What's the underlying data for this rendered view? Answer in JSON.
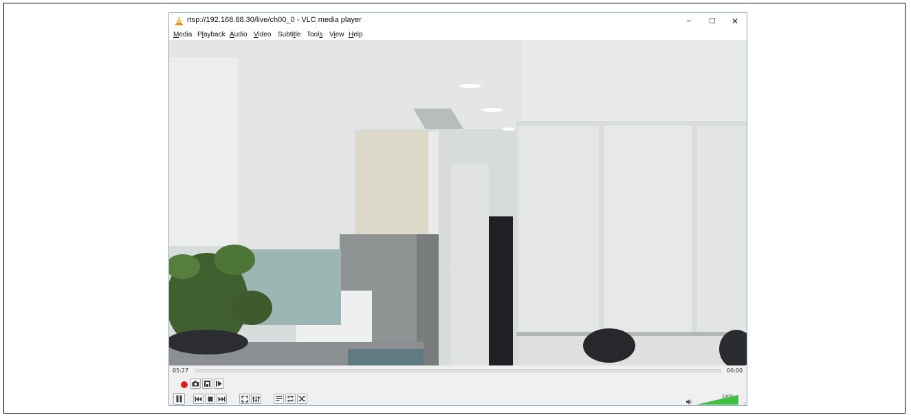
{
  "window": {
    "title": "rtsp://192.168.88.30/live/ch00_0 - VLC media player",
    "minimize_glyph": "−",
    "maximize_glyph": "☐",
    "close_glyph": "✕"
  },
  "menu": [
    {
      "pre": "",
      "u": "M",
      "post": "edia"
    },
    {
      "pre": "P",
      "u": "l",
      "post": "ayback"
    },
    {
      "pre": "",
      "u": "A",
      "post": "udio"
    },
    {
      "pre": "",
      "u": "V",
      "post": "ideo"
    },
    {
      "pre": "Subti",
      "u": "t",
      "post": "le"
    },
    {
      "pre": "Tool",
      "u": "s",
      "post": ""
    },
    {
      "pre": "V",
      "u": "i",
      "post": "ew"
    },
    {
      "pre": "",
      "u": "H",
      "post": "elp"
    }
  ],
  "playback": {
    "elapsed": "05:27",
    "remaining": "00:00",
    "volume_label": "100%",
    "volume_level": 1.0
  },
  "colors": {
    "record_red": "#e21b1b",
    "volume_green": "#3cc23c",
    "icon_dark": "#3a3a3a"
  },
  "icons": {
    "record": "record-icon",
    "snapshot": "camera-icon",
    "loop_ab": "loop-ab-icon",
    "frame_step": "frame-step-icon",
    "pause": "pause-icon",
    "previous": "previous-icon",
    "stop": "stop-icon",
    "next": "next-icon",
    "fullscreen": "fullscreen-icon",
    "extended": "equalizer-icon",
    "playlist": "playlist-icon",
    "loop": "loop-icon",
    "shuffle": "shuffle-icon",
    "volume": "speaker-icon"
  }
}
